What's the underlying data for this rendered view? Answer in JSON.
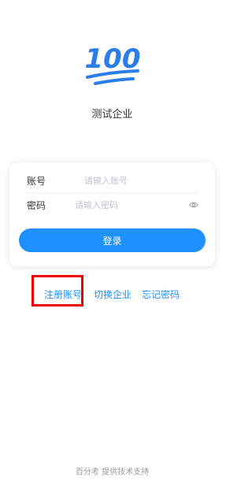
{
  "logo": {
    "icon": "logo-100-icon",
    "color": "#2b7ee8"
  },
  "company": {
    "name": "测试企业"
  },
  "form": {
    "account_label": "账号",
    "account_placeholder": "请输入账号",
    "password_label": "密码",
    "password_placeholder": "请输入密码",
    "password_toggle_icon": "eye-icon",
    "login_label": "登录"
  },
  "links": {
    "register": "注册账号",
    "switch_company": "切换企业",
    "forgot_password": "忘记密码"
  },
  "footer": {
    "text": "百分考 提供技术支持"
  },
  "colors": {
    "accent": "#1e90ff",
    "highlight": "#ee0000"
  }
}
